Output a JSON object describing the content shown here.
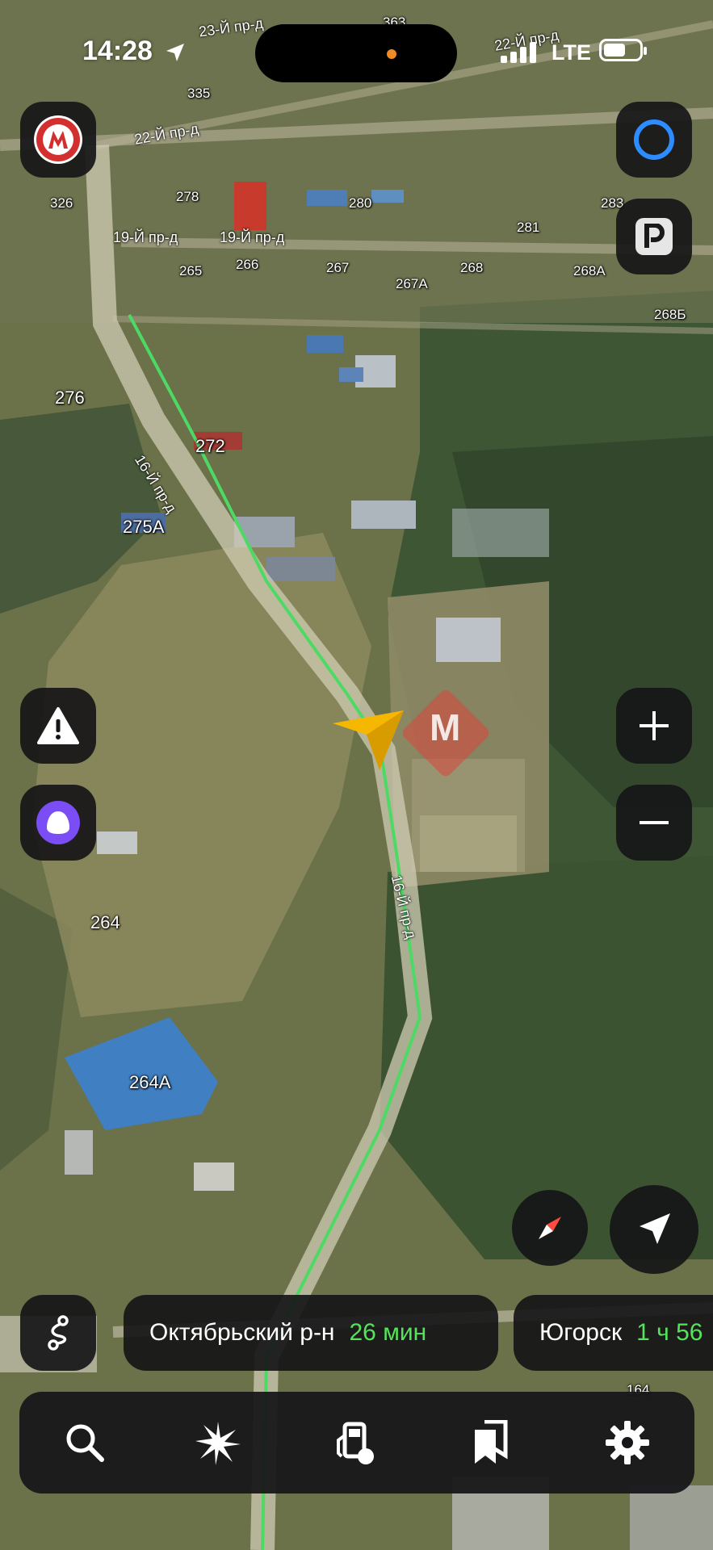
{
  "status_bar": {
    "time": "14:28",
    "network": "LTE"
  },
  "map": {
    "house_numbers": [
      "363",
      "335",
      "326",
      "278",
      "280",
      "283",
      "281",
      "265",
      "266",
      "267",
      "268",
      "268А",
      "267А",
      "268Б",
      "276",
      "272",
      "275А",
      "264",
      "264А",
      "164"
    ],
    "street_labels": [
      "23-Й пр-д",
      "22-Й пр-д",
      "22-Й пр-д",
      "19-Й пр-д",
      "19-Й пр-д",
      "16-Й пр-д",
      "16-Й пр-д"
    ],
    "route_color": "#4cd964",
    "marker_color": "#f5b700",
    "brand_watermark": "М"
  },
  "route_options": [
    {
      "destination": "Октябрьский р-н",
      "eta": "26 мин"
    },
    {
      "destination": "Югорск",
      "eta": "1 ч 56"
    }
  ],
  "colors": {
    "panel": "#161618",
    "eta_green": "#54e35a",
    "alice_purple": "#7a4df5"
  },
  "tabs": [
    "search-icon",
    "sparkle-icon",
    "fuel-icon",
    "bookmarks-icon",
    "gear-icon"
  ]
}
